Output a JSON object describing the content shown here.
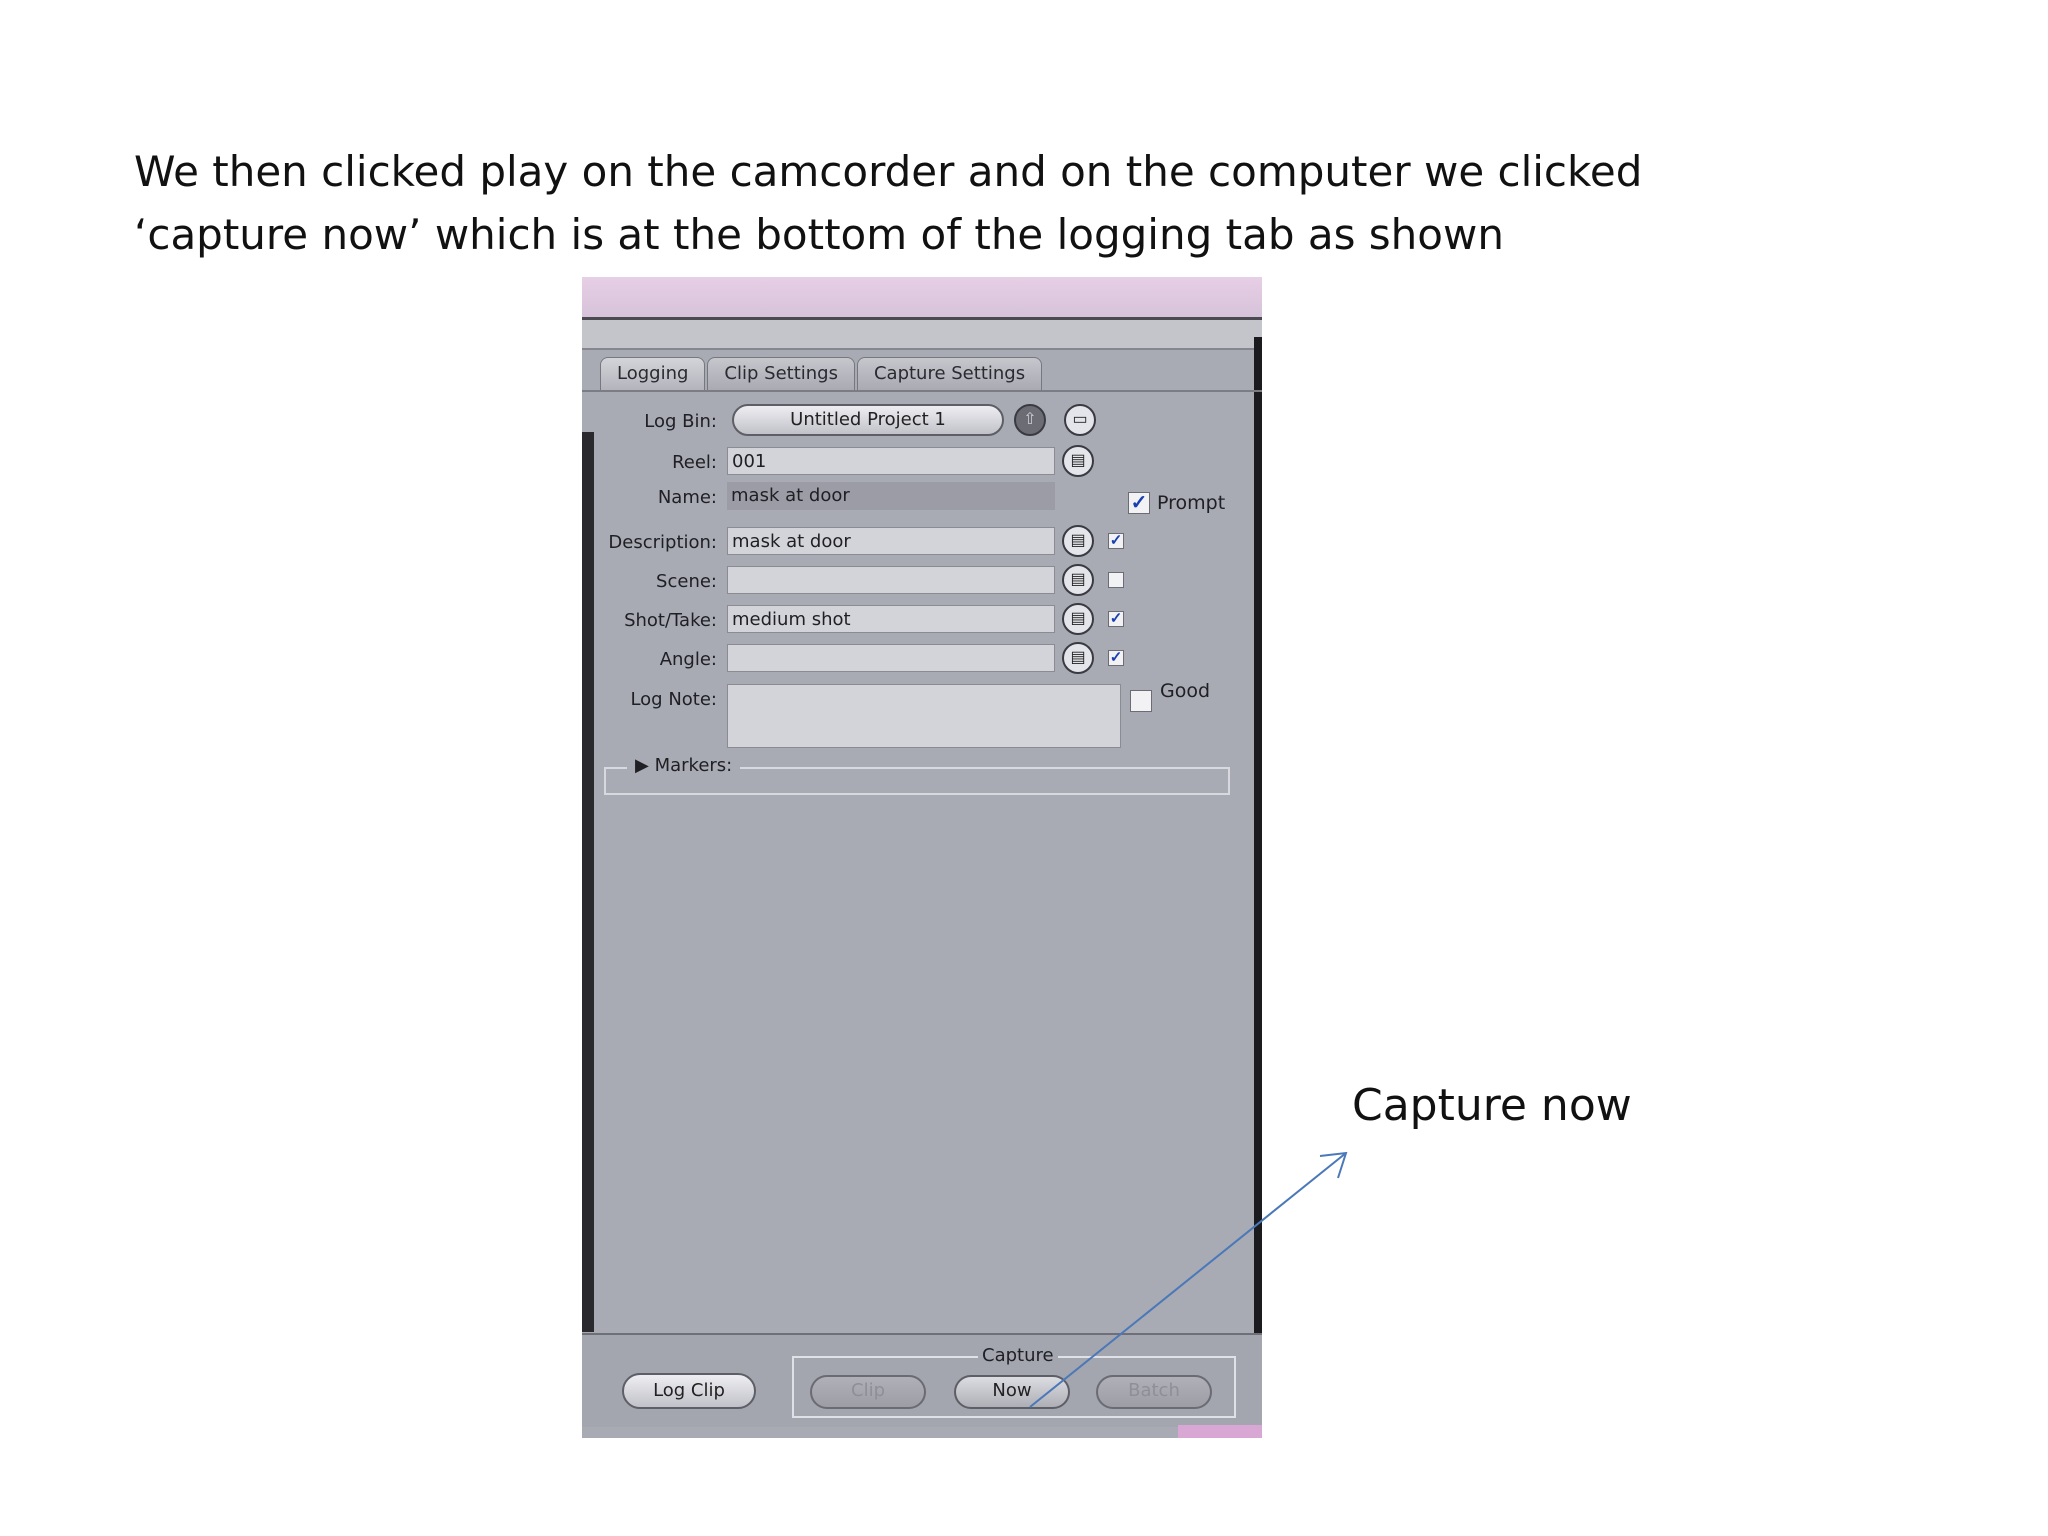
{
  "caption": {
    "line1": "We then clicked play on the camcorder and on the computer we clicked",
    "line2": "‘capture now’ which is at the bottom of the logging tab as shown"
  },
  "tabs": [
    "Logging",
    "Clip Settings",
    "Capture Settings"
  ],
  "log_bin": {
    "label": "Log Bin:",
    "value": "Untitled Project 1"
  },
  "fields": {
    "reel": {
      "label": "Reel:",
      "value": "001"
    },
    "name": {
      "label": "Name:",
      "value": "mask at door"
    },
    "description": {
      "label": "Description:",
      "value": "mask at door",
      "checked": true
    },
    "scene": {
      "label": "Scene:",
      "value": "",
      "checked": false
    },
    "shot_take": {
      "label": "Shot/Take:",
      "value": "medium shot",
      "checked": true
    },
    "angle": {
      "label": "Angle:",
      "value": "",
      "checked": true
    },
    "log_note": {
      "label": "Log Note:",
      "value": ""
    }
  },
  "prompt": {
    "label": "Prompt",
    "checked": true
  },
  "good": {
    "label": "Good",
    "checked": false
  },
  "markers": {
    "label": "Markers:"
  },
  "buttons": {
    "log_clip": "Log Clip",
    "capture_label": "Capture",
    "clip": "Clip",
    "now": "Now",
    "batch": "Batch"
  },
  "annotation": "Capture now",
  "colors": {
    "arrow": "#4a78b8",
    "check": "#1a3fb0"
  }
}
